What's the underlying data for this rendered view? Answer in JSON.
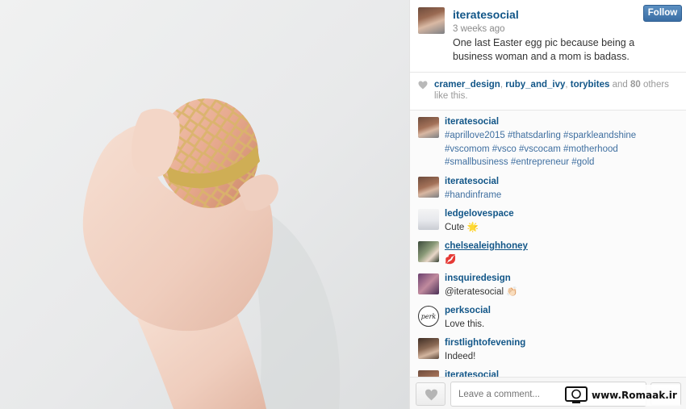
{
  "post": {
    "owner": "iteratesocial",
    "time": "3 weeks ago",
    "caption": "One last Easter egg pic because being a business woman and a mom is badass.",
    "follow_label": "Follow"
  },
  "likes": {
    "users": [
      "cramer_design",
      "ruby_and_ivy",
      "torybites"
    ],
    "sep": ",",
    "and_text": "and",
    "count": "80",
    "tail": "others like this."
  },
  "comments": [
    {
      "user": "iteratesocial",
      "text": "#aprillove2015 #thatsdarling #sparkleandshine #vscomom #vsco #vscocam #motherhood #smallbusiness #entrepreneur #gold"
    },
    {
      "user": "iteratesocial",
      "text": "#handinframe"
    },
    {
      "user": "ledgelovespace",
      "text": "Cute 🌟"
    },
    {
      "user": "chelsealeighhoney",
      "text": "💋"
    },
    {
      "user": "insquiredesign",
      "text": "@iteratesocial 👏🏻"
    },
    {
      "user": "perksocial",
      "text": "Love this.",
      "avatar_text": "perk"
    },
    {
      "user": "firstlightofevening",
      "text": "Indeed!"
    },
    {
      "user": "iteratesocial",
      "text": ""
    }
  ],
  "footer": {
    "comment_placeholder": "Leave a comment...",
    "more_label": "..."
  },
  "watermark": {
    "text": "www.Romaak.ir"
  },
  "colors": {
    "link": "#125688",
    "hashtag": "#3f6fa0",
    "follow": "#3a6ea5"
  },
  "icons": [
    "heart-icon",
    "ellipsis-icon"
  ]
}
